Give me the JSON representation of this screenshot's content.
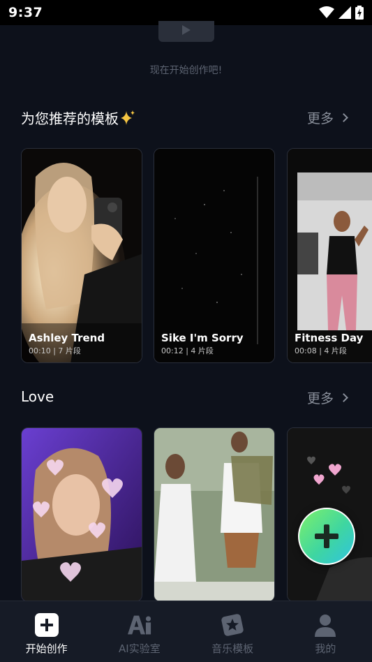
{
  "status_bar": {
    "time": "9:37"
  },
  "empty_state": {
    "message": "现在开始创作吧!"
  },
  "recommended": {
    "title": "为您推荐的模板",
    "more_label": "更多",
    "cards": [
      {
        "title": "Ashley Trend",
        "meta": "00:10 | 7 片段"
      },
      {
        "title": "Sike I'm Sorry",
        "meta": "00:12 | 4 片段"
      },
      {
        "title": "Fitness Day",
        "meta": "00:08 | 4 片段"
      }
    ]
  },
  "love": {
    "title": "Love",
    "more_label": "更多"
  },
  "bottom_nav": {
    "items": [
      {
        "label": "开始创作",
        "icon": "plus-square-icon",
        "active": true
      },
      {
        "label": "AI实验室",
        "icon": "ai-icon",
        "active": false
      },
      {
        "label": "音乐模板",
        "icon": "music-star-icon",
        "active": false
      },
      {
        "label": "我的",
        "icon": "user-icon",
        "active": false
      }
    ]
  },
  "fab": {
    "icon": "plus-icon"
  },
  "colors": {
    "background": "#0d111b",
    "nav_bg": "#161b26",
    "muted": "#5d6472",
    "fab_gradient_start": "#7df06a",
    "fab_gradient_end": "#2fc3e0"
  }
}
